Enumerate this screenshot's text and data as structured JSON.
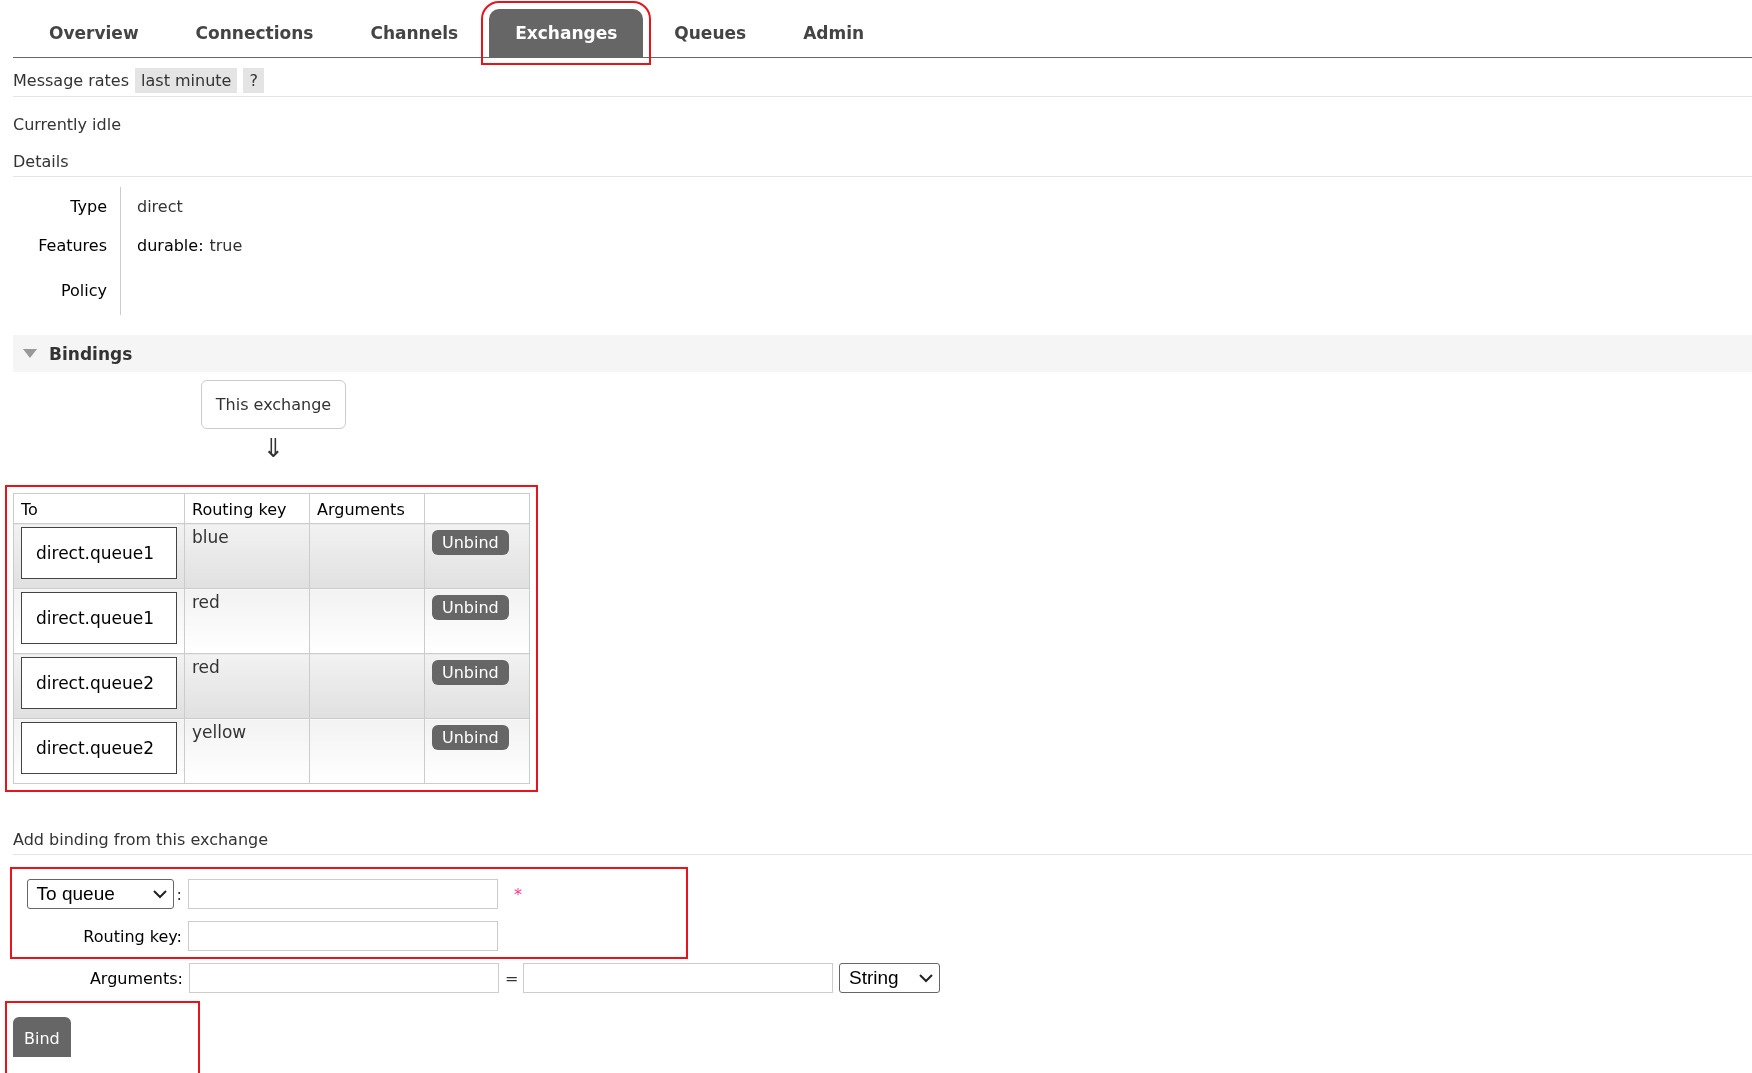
{
  "tabs": [
    {
      "label": "Overview",
      "selected": false,
      "highlighted": false
    },
    {
      "label": "Connections",
      "selected": false,
      "highlighted": false
    },
    {
      "label": "Channels",
      "selected": false,
      "highlighted": false
    },
    {
      "label": "Exchanges",
      "selected": true,
      "highlighted": true
    },
    {
      "label": "Queues",
      "selected": false,
      "highlighted": false
    },
    {
      "label": "Admin",
      "selected": false,
      "highlighted": false
    }
  ],
  "message_rates": {
    "label": "Message rates",
    "period": "last minute",
    "help": "?"
  },
  "status": "Currently idle",
  "details": {
    "heading": "Details",
    "rows": [
      {
        "label": "Type",
        "value": "direct"
      },
      {
        "label": "Features",
        "key": "durable:",
        "value": "true"
      },
      {
        "label": "Policy"
      }
    ]
  },
  "bindings": {
    "title": "Bindings",
    "expanded": true,
    "source": "This exchange",
    "arrow": "⇓",
    "table": {
      "highlighted": true,
      "columns": [
        "To",
        "Routing key",
        "Arguments"
      ],
      "rows": [
        {
          "to": "direct.queue1",
          "routing_key": "blue",
          "action": "Unbind"
        },
        {
          "to": "direct.queue1",
          "routing_key": "red",
          "action": "Unbind"
        },
        {
          "to": "direct.queue2",
          "routing_key": "red",
          "action": "Unbind"
        },
        {
          "to": "direct.queue2",
          "routing_key": "yellow",
          "action": "Unbind"
        }
      ]
    }
  },
  "add_binding": {
    "heading": "Add binding from this exchange",
    "highlighted": true,
    "destination_type": "To queue",
    "colon": ":",
    "required_mark": "*",
    "routing_key_label": "Routing key:",
    "arguments_label": "Arguments:",
    "equals": "=",
    "argument_type": "String"
  },
  "bind_button": {
    "label": "Bind",
    "highlighted": true
  }
}
